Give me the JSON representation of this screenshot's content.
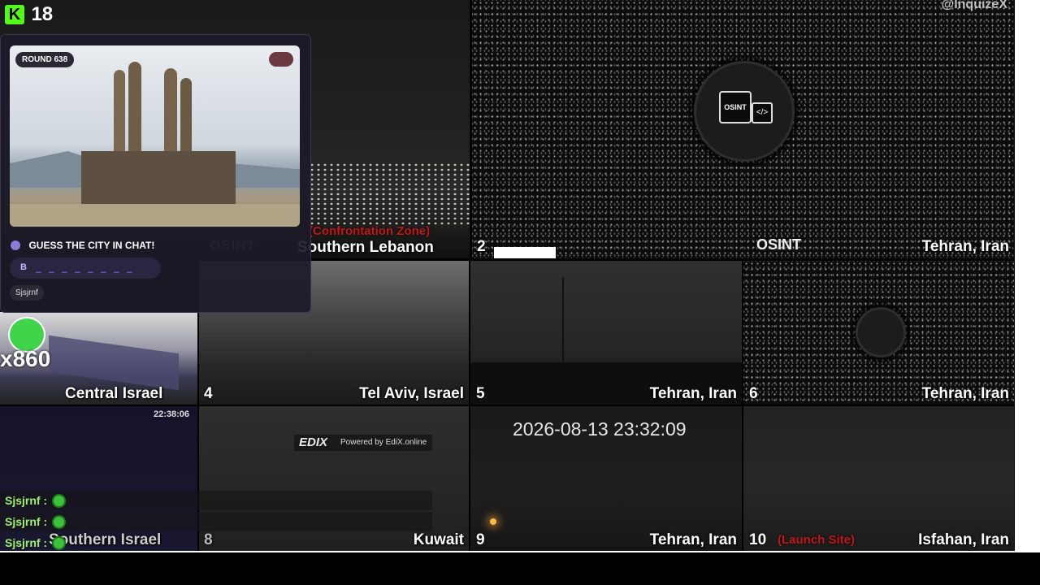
{
  "viewers": {
    "count": "18"
  },
  "watermark": "@InquizeX",
  "quiz": {
    "round": "ROUND 638",
    "prompt": "GUESS THE CITY IN CHAT!",
    "hint_letter": "B",
    "hint_blanks": "_ _ _ _ _ _ _ _",
    "last_user": "Sjsjrnf"
  },
  "streak": {
    "label": "x860"
  },
  "feeds": {
    "f1": {
      "label": "Southern Lebanon",
      "tag": "(Confrontation Zone)"
    },
    "f2": {
      "num": "2",
      "label": "Tehran, Iran",
      "brand": "OSINT"
    },
    "f3": {
      "label": "Central Israel"
    },
    "f4": {
      "num": "4",
      "label": "Tel Aviv, Israel"
    },
    "f5": {
      "num": "5",
      "label": "Tehran, Iran"
    },
    "f6": {
      "num": "6",
      "label": "Tehran, Iran"
    },
    "f7": {
      "label": "Southern Israel",
      "time": "22:38:06"
    },
    "f8": {
      "num": "8",
      "label": "Kuwait",
      "powered": "Powered by EdiX.online",
      "edix": "EDIX"
    },
    "f9": {
      "num": "9",
      "label": "Tehran, Iran",
      "timestamp": "2026-08-13 23:32:09"
    },
    "f10": {
      "num": "10",
      "label": "Isfahan, Iran",
      "tag": "(Launch Site)"
    }
  },
  "osint_mark": "OSINT",
  "chat": [
    {
      "user": "Sjsjrnf :"
    },
    {
      "user": "Sjsjrnf :"
    },
    {
      "user": "Sjsjrnf :"
    }
  ]
}
